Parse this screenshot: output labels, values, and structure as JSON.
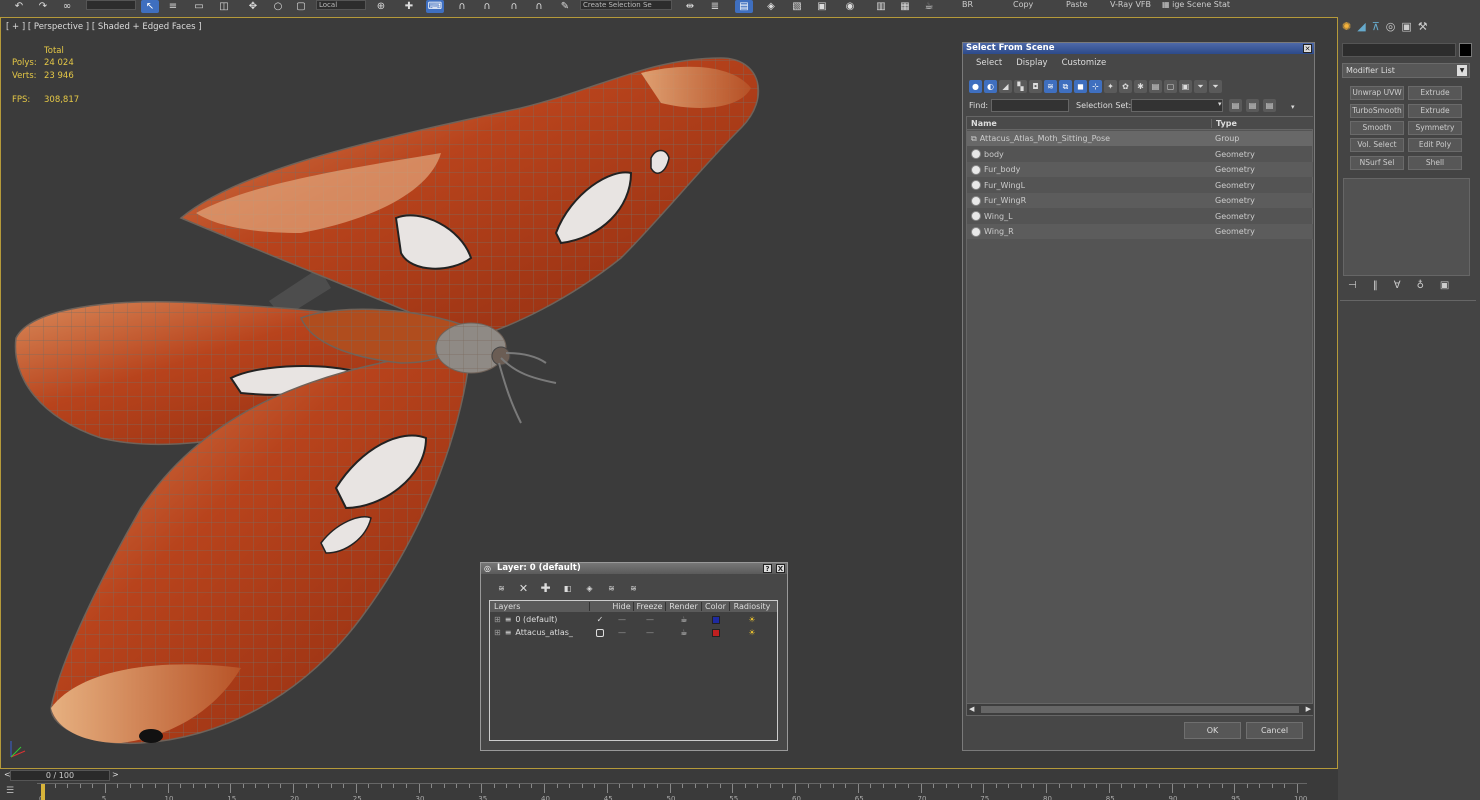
{
  "toolbar": {
    "items": [
      "undo",
      "redo",
      "select-link",
      "unlink",
      "bind-space-warp",
      "layer-field",
      "select-object",
      "select-by-name",
      "rect-select",
      "window-crossing",
      "move",
      "rotate",
      "scale",
      "ref-coord",
      "pivot",
      "select-manipulate",
      "snaps",
      "angle-snap",
      "percent-snap",
      "spinner-snap",
      "edit-named-sel",
      "named-sel-field",
      "mirror",
      "align",
      "layer-manager",
      "graphite",
      "curve-editor",
      "schematic",
      "material-editor",
      "render-setup",
      "rendered-frame",
      "render"
    ],
    "coord_system": "Local",
    "named_set": "Create Selection Se",
    "right_labels": [
      "BR",
      "Copy",
      "Paste",
      "V-Ray VFB",
      "ige Scene Stat"
    ]
  },
  "viewport": {
    "label": "[ + ] [ Perspective ] [ Shaded + Edged Faces ]",
    "stats": {
      "header": "Total",
      "polys_label": "Polys:",
      "polys": "24 024",
      "verts_label": "Verts:",
      "verts": "23 946",
      "fps_label": "FPS:",
      "fps": "308,817"
    }
  },
  "select_from_scene": {
    "title": "Select From Scene",
    "menu": [
      "Select",
      "Display",
      "Customize"
    ],
    "find_label": "Find:",
    "selset_label": "Selection Set:",
    "columns": [
      "Name",
      "Type"
    ],
    "rows": [
      {
        "name": "Attacus_Atlas_Moth_Sitting_Pose",
        "type": "Group"
      },
      {
        "name": "body",
        "type": "Geometry"
      },
      {
        "name": "Fur_body",
        "type": "Geometry"
      },
      {
        "name": "Fur_WingL",
        "type": "Geometry"
      },
      {
        "name": "Fur_WingR",
        "type": "Geometry"
      },
      {
        "name": "Wing_L",
        "type": "Geometry"
      },
      {
        "name": "Wing_R",
        "type": "Geometry"
      }
    ],
    "ok": "OK",
    "cancel": "Cancel"
  },
  "layer_dialog": {
    "title": "Layer: 0 (default)",
    "help": "?",
    "close": "X",
    "columns": [
      "Layers",
      "Hide",
      "Freeze",
      "Render",
      "Color",
      "Radiosity"
    ],
    "rows": [
      {
        "name": "0 (default)",
        "color": "#1e2aa0"
      },
      {
        "name": "Attacus_atlas_",
        "color": "#c02020"
      }
    ]
  },
  "command_panel": {
    "modifier_list": "Modifier List",
    "buttons": [
      "Unwrap UVW",
      "Extrude",
      "TurboSmooth",
      "Extrude",
      "Smooth",
      "Symmetry",
      "Vol. Select",
      "Edit Poly",
      "NSurf Sel",
      "Shell"
    ]
  },
  "timeline": {
    "slider": "0 / 100",
    "prev": "<",
    "next": ">",
    "ticks": [
      "0",
      "5",
      "10",
      "15",
      "20",
      "25",
      "30",
      "35",
      "40",
      "45",
      "50",
      "55",
      "60",
      "65",
      "70",
      "75",
      "80",
      "85",
      "90",
      "95",
      "100"
    ]
  }
}
